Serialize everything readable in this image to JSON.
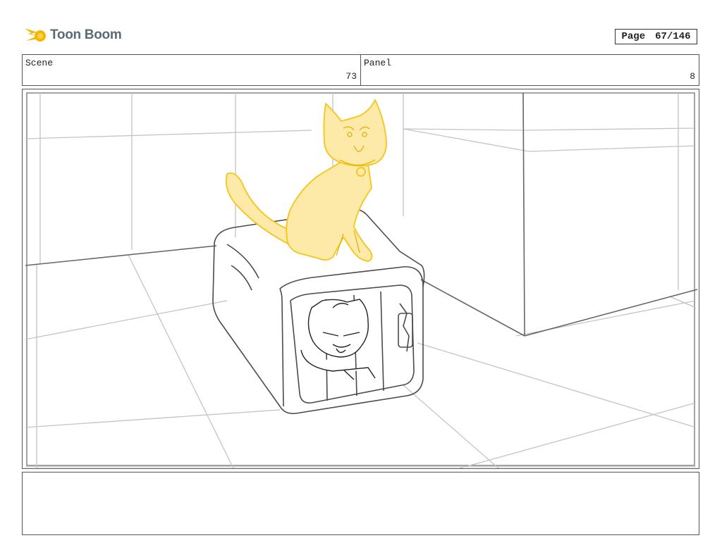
{
  "header": {
    "logo_text": "Toon Boom",
    "page_label": "Page",
    "page_value": "67/146"
  },
  "info": {
    "scene_label": "Scene",
    "scene_value": "73",
    "panel_label": "Panel",
    "panel_value": "8"
  },
  "colors": {
    "border": "#555555",
    "sketch_gray": "#b8b8b8",
    "ink": "#333333",
    "cat_fill": "#fde9a8",
    "cat_line": "#f5c518",
    "logo_accent": "#f7b500"
  },
  "icons": {
    "logo": "toon-boom-comet-icon"
  }
}
